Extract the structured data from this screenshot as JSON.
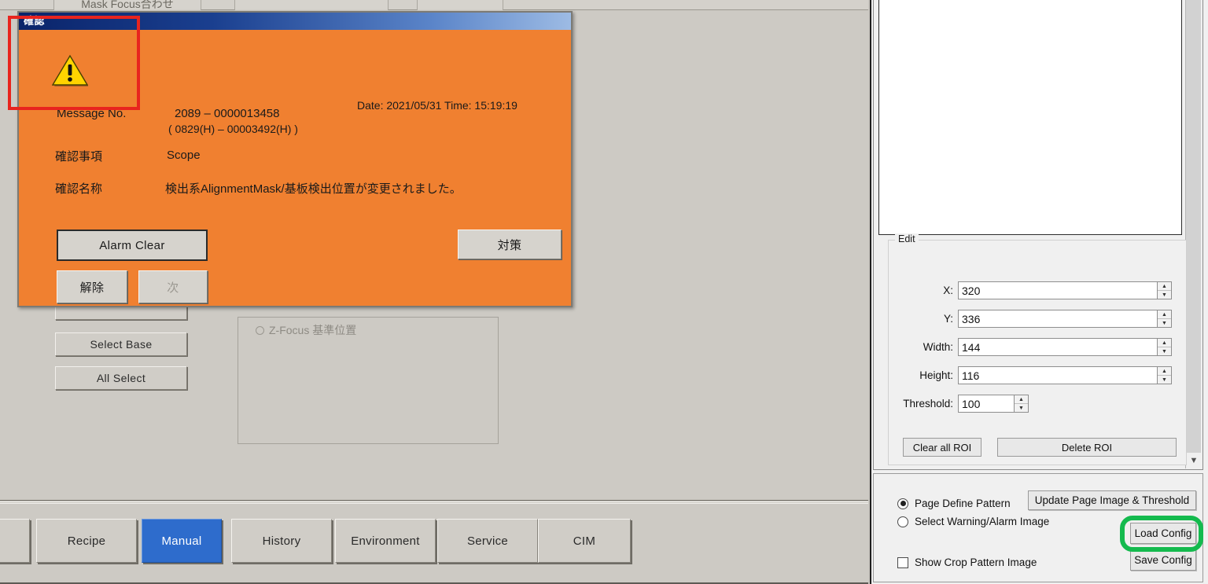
{
  "top_tabs": [
    {
      "label": "Mask Focus合わせ"
    },
    {
      "label": ""
    },
    {
      "label": ""
    }
  ],
  "left_panel": {
    "buttons": [
      {
        "label": ""
      },
      {
        "label": "Select Base"
      },
      {
        "label": "All Select"
      }
    ],
    "zfocus_group": {
      "radio_label": "Z-Focus 基準位置"
    }
  },
  "dialog": {
    "title": "確認",
    "icon": "warning-triangle-icon",
    "message_no_label": "Message No.",
    "message_no_value": "2089    – 0000013458",
    "message_no_hex": "( 0829(H) – 00003492(H) )",
    "datetime": "Date: 2021/05/31  Time: 15:19:19",
    "item_label": "確認事項",
    "item_value": "Scope",
    "name_label": "確認名称",
    "name_value": "検出系AlignmentMask/基板検出位置が変更されました。",
    "buttons": {
      "alarm_clear": "Alarm Clear",
      "countermeasure": "対策",
      "release": "解除",
      "next": "次"
    }
  },
  "bottom_nav": {
    "items": [
      {
        "label": "Recipe",
        "active": false
      },
      {
        "label": "Manual",
        "active": true
      },
      {
        "label": "History",
        "active": false
      },
      {
        "label": "Environment",
        "active": false
      },
      {
        "label": "Service",
        "active": false
      },
      {
        "label": "CIM",
        "active": false
      }
    ]
  },
  "right_panel": {
    "edit_group": {
      "legend": "Edit",
      "fields": [
        {
          "label": "X:",
          "value": "320"
        },
        {
          "label": "Y:",
          "value": "336"
        },
        {
          "label": "Width:",
          "value": "144"
        },
        {
          "label": "Height:",
          "value": "116"
        },
        {
          "label": "Threshold:",
          "value": "100"
        }
      ],
      "clear_all_roi": "Clear all ROI",
      "delete_roi": "Delete ROI"
    },
    "config": {
      "radio_page_define": "Page Define Pattern",
      "radio_select_warning": "Select Warning/Alarm Image",
      "checkbox_show_crop": "Show Crop Pattern Image",
      "update_page_button": "Update Page Image & Threshold",
      "load_config_button": "Load Config",
      "save_config_button": "Save Config"
    },
    "scrollbar_down_icon": "chevron-down-icon"
  },
  "annotations": {
    "red_box_color": "#e8241e",
    "green_box_color": "#14ba4e"
  },
  "colors": {
    "dialog_background": "#f08030",
    "active_tab": "#2e6ccc",
    "app_background": "#cdcac4"
  }
}
